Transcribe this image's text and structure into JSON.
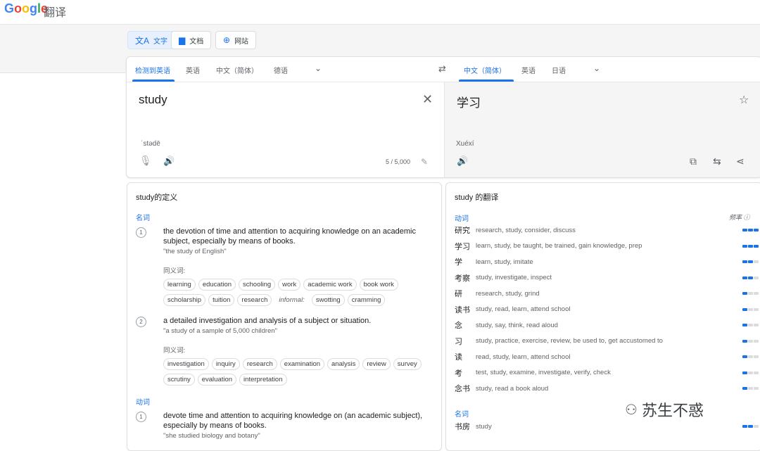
{
  "header": {
    "logo_letters": [
      "G",
      "o",
      "o",
      "g",
      "l",
      "e"
    ],
    "logo_colors": [
      "#4285F4",
      "#EA4335",
      "#FBBC05",
      "#4285F4",
      "#34A853",
      "#EA4335"
    ],
    "product": "翻译"
  },
  "modes": [
    {
      "label": "文字",
      "icon": "translate-icon"
    },
    {
      "label": "文档",
      "icon": "document-icon"
    },
    {
      "label": "网站",
      "icon": "globe-icon"
    }
  ],
  "source_langs": [
    "检测到英语",
    "英语",
    "中文（简体）",
    "德语"
  ],
  "target_langs": [
    "中文（简体）",
    "英语",
    "日语"
  ],
  "source": {
    "text": "study",
    "translit": "ˈstədē",
    "count": "5 / 5,000"
  },
  "target": {
    "text": "学习",
    "translit": "Xuéxí"
  },
  "definitions": {
    "title": "study的定义",
    "noun_label": "名词",
    "verb_label": "动词",
    "syn_label": "同义词:",
    "informal_label": "informal:",
    "d1": {
      "num": "1",
      "text": "the devotion of time and attention to acquiring knowledge on an academic subject, especially by means of books.",
      "example": "\"the study of English\""
    },
    "d1_syn_row1": [
      "learning",
      "education",
      "schooling",
      "work",
      "academic work",
      "book work"
    ],
    "d1_syn_row2a": [
      "scholarship",
      "tuition",
      "research"
    ],
    "d1_syn_row2b": [
      "swotting",
      "cramming"
    ],
    "d2": {
      "num": "2",
      "text": "a detailed investigation and analysis of a subject or situation.",
      "example": "\"a study of a sample of 5,000 children\""
    },
    "d2_syn_row1": [
      "investigation",
      "inquiry",
      "research",
      "examination",
      "analysis",
      "review",
      "survey"
    ],
    "d2_syn_row2": [
      "scrutiny",
      "evaluation",
      "interpretation"
    ],
    "v1": {
      "num": "1",
      "text": "devote time and attention to acquiring knowledge on (an academic subject), especially by means of books.",
      "example": "\"she studied biology and botany\""
    }
  },
  "translations": {
    "title": "study 的翻译",
    "verb_label": "动词",
    "noun_label": "名词",
    "freq_label": "频率",
    "verbs": [
      {
        "word": "研究",
        "syn": "research, study, consider, discuss",
        "freq": 3
      },
      {
        "word": "学习",
        "syn": "learn, study, be taught, be trained, gain knowledge, prep",
        "freq": 3
      },
      {
        "word": "学",
        "syn": "learn, study, imitate",
        "freq": 2
      },
      {
        "word": "考察",
        "syn": "study, investigate, inspect",
        "freq": 2
      },
      {
        "word": "研",
        "syn": "research, study, grind",
        "freq": 1
      },
      {
        "word": "读书",
        "syn": "study, read, learn, attend school",
        "freq": 1
      },
      {
        "word": "念",
        "syn": "study, say, think, read aloud",
        "freq": 1
      },
      {
        "word": "习",
        "syn": "study, practice, exercise, review, be used to, get accustomed to",
        "freq": 1
      },
      {
        "word": "读",
        "syn": "read, study, learn, attend school",
        "freq": 1
      },
      {
        "word": "考",
        "syn": "test, study, examine, investigate, verify, check",
        "freq": 1
      },
      {
        "word": "念书",
        "syn": "study, read a book aloud",
        "freq": 1
      }
    ],
    "nouns": [
      {
        "word": "书房",
        "syn": "study",
        "freq": 2
      }
    ]
  },
  "watermark": "苏生不惑"
}
